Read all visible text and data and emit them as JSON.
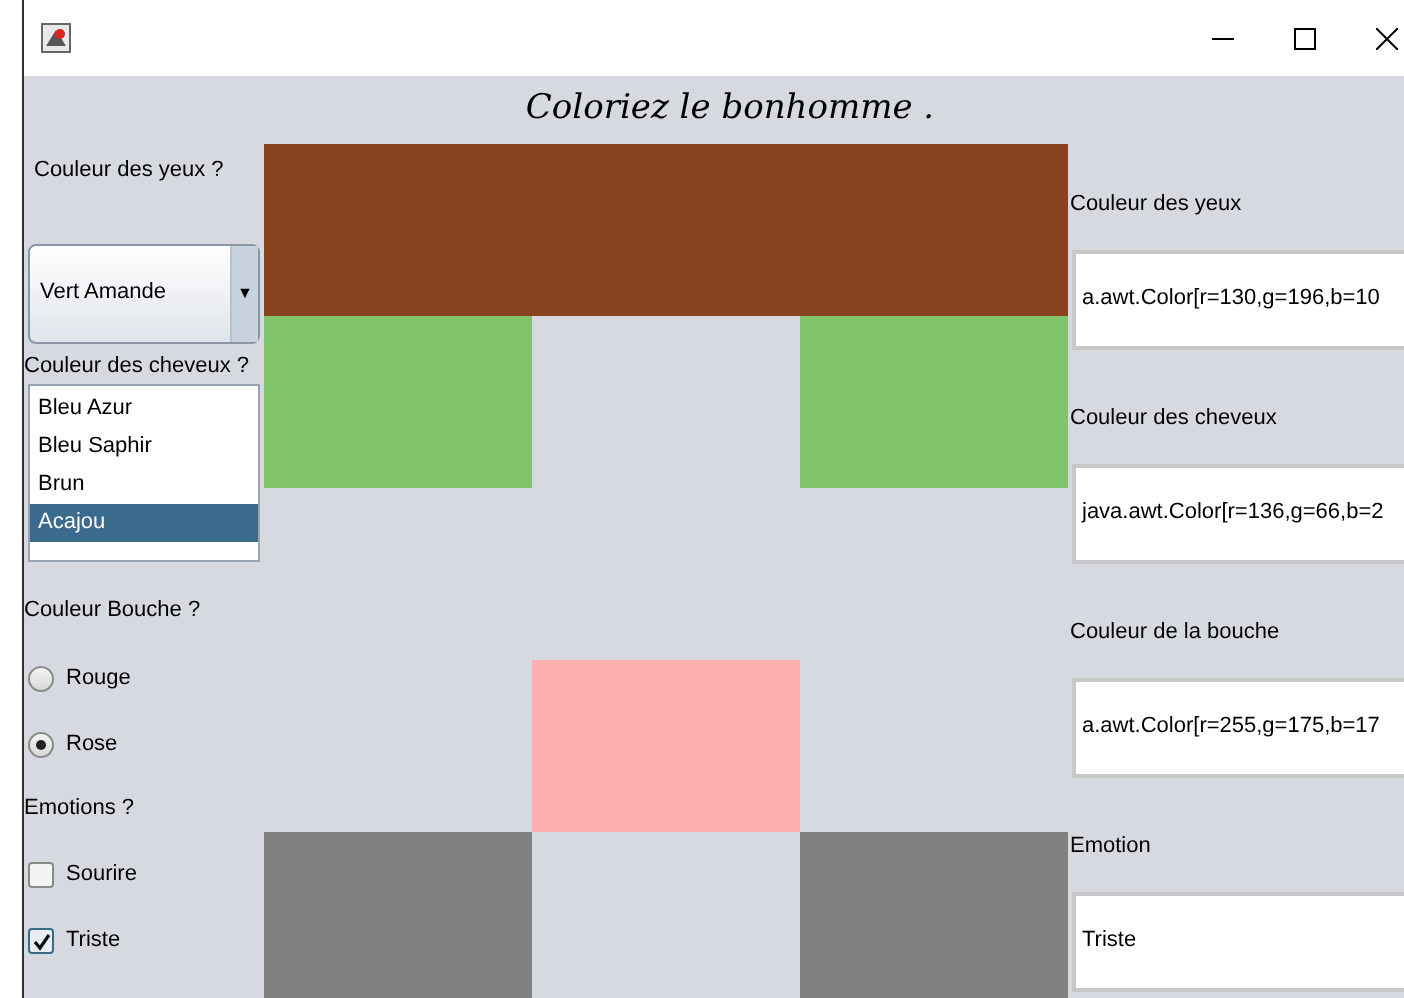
{
  "heading": "Coloriez le bonhomme .",
  "left_panel": {
    "eyes_label": "Couleur des yeux ?",
    "eyes_combo": {
      "value": "Vert Amande",
      "arrow": "▼"
    },
    "hair_label": "Couleur des cheveux ?",
    "hair_list": [
      {
        "label": "Bleu Azur",
        "selected": false
      },
      {
        "label": "Bleu Saphir",
        "selected": false
      },
      {
        "label": "Brun",
        "selected": false
      },
      {
        "label": "Acajou",
        "selected": true
      }
    ],
    "mouth_label": "Couleur Bouche ?",
    "mouth_radios": [
      {
        "label": "Rouge",
        "selected": false
      },
      {
        "label": "Rose",
        "selected": true
      }
    ],
    "emotions_label": "Emotions ?",
    "emotions_checks": [
      {
        "label": "Sourire",
        "checked": false
      },
      {
        "label": "Triste",
        "checked": true
      }
    ]
  },
  "face_parts": [
    {
      "kind": "hair",
      "color": "#88421d"
    },
    {
      "kind": "eyes",
      "color": "#82c46c"
    },
    {
      "kind": "mouth",
      "color": "#ffafaf"
    },
    {
      "kind": "emotion",
      "color": "#808080"
    }
  ],
  "right_panel": [
    {
      "label": "Couleur des yeux",
      "value": "a.awt.Color[r=130,g=196,b=10"
    },
    {
      "label": "Couleur des cheveux",
      "value": "java.awt.Color[r=136,g=66,b=2"
    },
    {
      "label": "Couleur de la bouche",
      "value": "a.awt.Color[r=255,g=175,b=17"
    },
    {
      "label": "Emotion",
      "value": "Triste"
    }
  ]
}
